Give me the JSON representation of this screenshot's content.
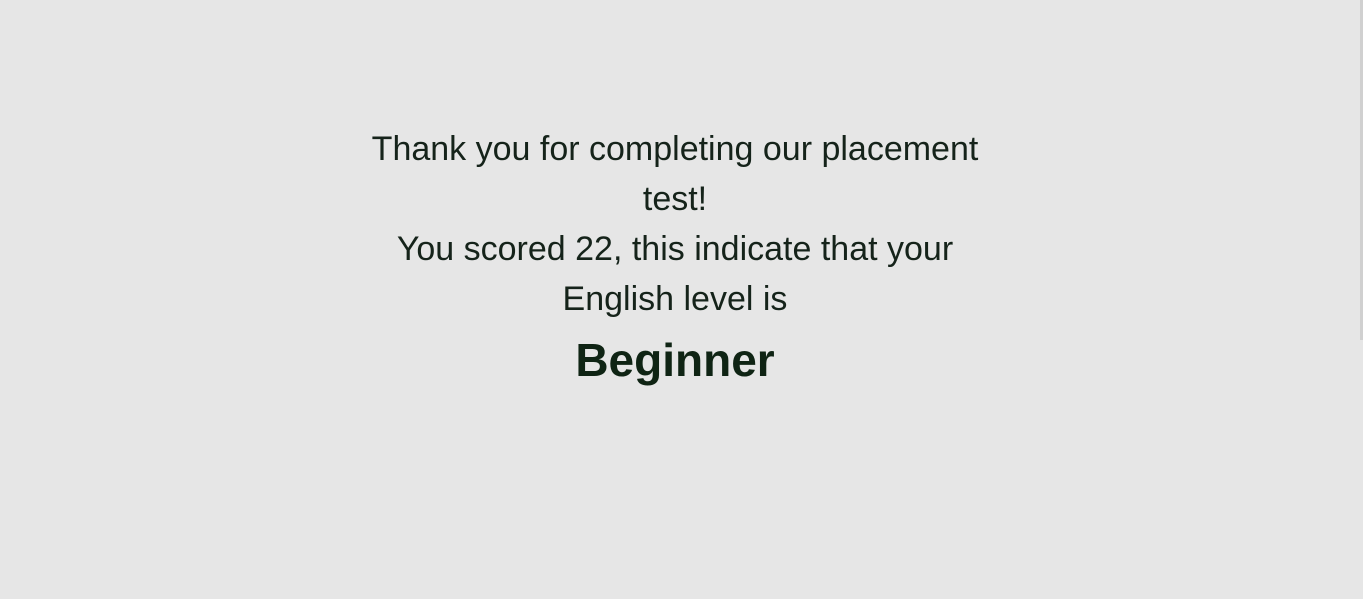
{
  "result": {
    "thank_you": "Thank you for completing our placement test!",
    "score_text": "You scored 22, this indicate that your English level is",
    "level": "Beginner"
  },
  "colors": {
    "background": "#e6e6e6",
    "text": "#15231a",
    "level_text": "#0f2414"
  }
}
